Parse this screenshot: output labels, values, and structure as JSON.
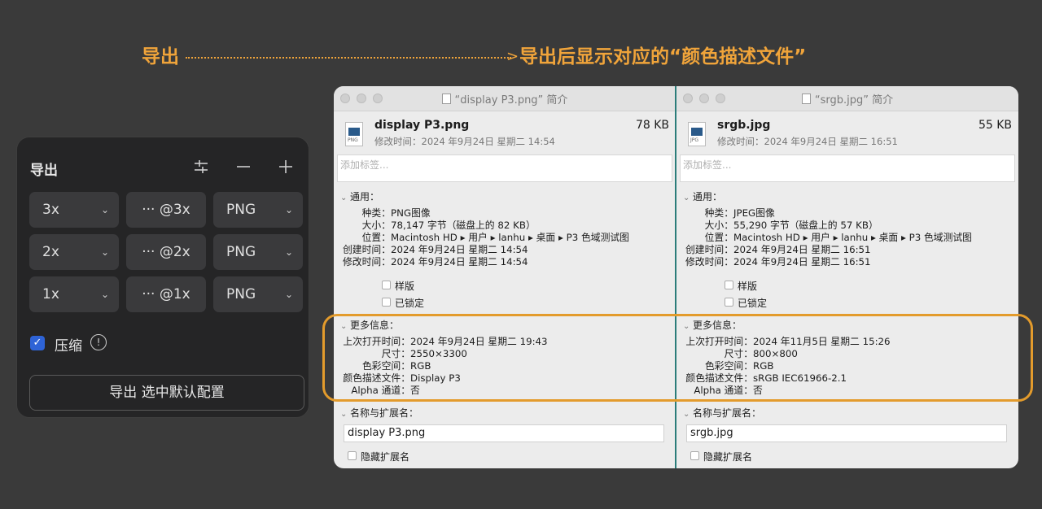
{
  "annotation": {
    "left": "导出",
    "right": "导出后显示对应的“颜色描述文件”"
  },
  "export_panel": {
    "title": "导出",
    "rows": [
      {
        "scale": "3x",
        "suffix": "··· @3x",
        "format": "PNG"
      },
      {
        "scale": "2x",
        "suffix": "··· @2x",
        "format": "PNG"
      },
      {
        "scale": "1x",
        "suffix": "··· @1x",
        "format": "PNG"
      }
    ],
    "compress_label": "压缩",
    "compress_checked": true,
    "export_button": "导出 选中默认配置"
  },
  "windows": [
    {
      "title": "“display P3.png” 简介",
      "filename": "display P3.png",
      "size": "78 KB",
      "icon_tag": "PNG",
      "modified_line": "修改时间：2024 年9月24日 星期二 14:54",
      "tags_placeholder": "添加标签...",
      "general_label": "通用：",
      "general": [
        {
          "k": "种类：",
          "v": "PNG图像"
        },
        {
          "k": "大小：",
          "v": "78,147 字节（磁盘上的 82 KB）"
        },
        {
          "k": "位置：",
          "v": "Macintosh HD ▸ 用户 ▸ lanhu ▸ 桌面 ▸ P3 色域测试图"
        },
        {
          "k": "创建时间：",
          "v": "2024 年9月24日 星期二 14:54"
        },
        {
          "k": "修改时间：",
          "v": "2024 年9月24日 星期二 14:54"
        }
      ],
      "stationery_label": "样版",
      "locked_label": "已锁定",
      "more_label": "更多信息：",
      "more": [
        {
          "k": "上次打开时间：",
          "v": "2024 年9月24日 星期二 19:43"
        },
        {
          "k": "尺寸：",
          "v": "2550×3300"
        },
        {
          "k": "色彩空间：",
          "v": "RGB"
        },
        {
          "k": "颜色描述文件：",
          "v": "Display P3"
        },
        {
          "k": "Alpha 通道：",
          "v": "否"
        }
      ],
      "name_label": "名称与扩展名：",
      "name_value": "display P3.png",
      "hide_ext_label": "隐藏扩展名"
    },
    {
      "title": "“srgb.jpg” 简介",
      "filename": "srgb.jpg",
      "size": "55 KB",
      "icon_tag": "JPG",
      "modified_line": "修改时间：2024 年9月24日 星期二 16:51",
      "tags_placeholder": "添加标签...",
      "general_label": "通用：",
      "general": [
        {
          "k": "种类：",
          "v": "JPEG图像"
        },
        {
          "k": "大小：",
          "v": "55,290 字节（磁盘上的 57 KB）"
        },
        {
          "k": "位置：",
          "v": "Macintosh HD ▸ 用户 ▸ lanhu ▸ 桌面 ▸ P3 色域测试图"
        },
        {
          "k": "创建时间：",
          "v": "2024 年9月24日 星期二 16:51"
        },
        {
          "k": "修改时间：",
          "v": "2024 年9月24日 星期二 16:51"
        }
      ],
      "stationery_label": "样版",
      "locked_label": "已锁定",
      "more_label": "更多信息：",
      "more": [
        {
          "k": "上次打开时间：",
          "v": "2024 年11月5日 星期二 15:26"
        },
        {
          "k": "尺寸：",
          "v": "800×800"
        },
        {
          "k": "色彩空间：",
          "v": "RGB"
        },
        {
          "k": "颜色描述文件：",
          "v": "sRGB IEC61966-2.1"
        },
        {
          "k": "Alpha 通道：",
          "v": "否"
        }
      ],
      "name_label": "名称与扩展名：",
      "name_value": "srgb.jpg",
      "hide_ext_label": "隐藏扩展名"
    }
  ],
  "colors": {
    "annotation": "#f0a43a",
    "highlight": "#e39b2c",
    "checkbox": "#2e63d6"
  }
}
